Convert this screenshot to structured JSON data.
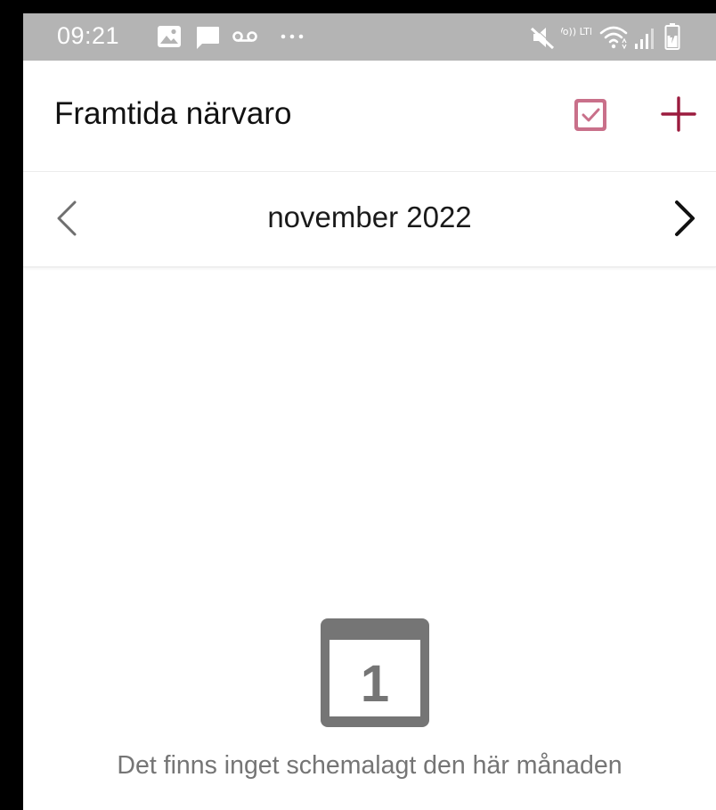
{
  "status_bar": {
    "time": "09:21",
    "left_icons": [
      "image-notification-icon",
      "message-notification-icon",
      "voicemail-icon",
      "more-notifications-icon"
    ],
    "network_label": "Vo)) LTE",
    "right_icons": [
      "mute-icon",
      "volte-icon",
      "wifi-icon",
      "signal-icon",
      "battery-icon"
    ]
  },
  "header": {
    "title": "Framtida närvaro",
    "actions": [
      "checkbox-icon",
      "add-icon"
    ]
  },
  "month_nav": {
    "label": "november 2022"
  },
  "empty_state": {
    "icon_day": "1",
    "message": "Det finns inget schemalagt den här månaden"
  },
  "colors": {
    "status_bar": "#b4b4b4",
    "accent": "#9b1b3e",
    "accent_light": "#c9708a",
    "empty_icon": "#757575",
    "empty_text": "#757575"
  }
}
